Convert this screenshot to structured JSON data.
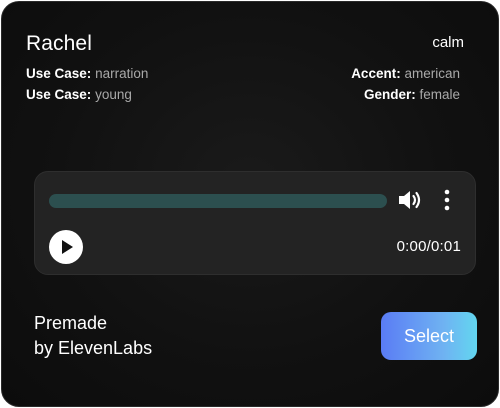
{
  "voice": {
    "name": "Rachel",
    "tone": "calm"
  },
  "meta": {
    "use_case_1": {
      "label": "Use Case:",
      "value": "narration"
    },
    "use_case_2": {
      "label": "Use Case:",
      "value": "young"
    },
    "accent": {
      "label": "Accent:",
      "value": "american"
    },
    "gender": {
      "label": "Gender:",
      "value": "female"
    }
  },
  "player": {
    "time": "0:00/0:01",
    "progress": 0,
    "icons": [
      "volume-icon",
      "more-vertical-icon",
      "play-icon"
    ],
    "colors": {
      "track": "#2c4f4f",
      "background": "#232323"
    }
  },
  "owner": {
    "line1": "Premade",
    "line2": "by ElevenLabs"
  },
  "actions": {
    "select_label": "Select",
    "gradient_start": "#5a7cf5",
    "gradient_end": "#62d6f0"
  }
}
